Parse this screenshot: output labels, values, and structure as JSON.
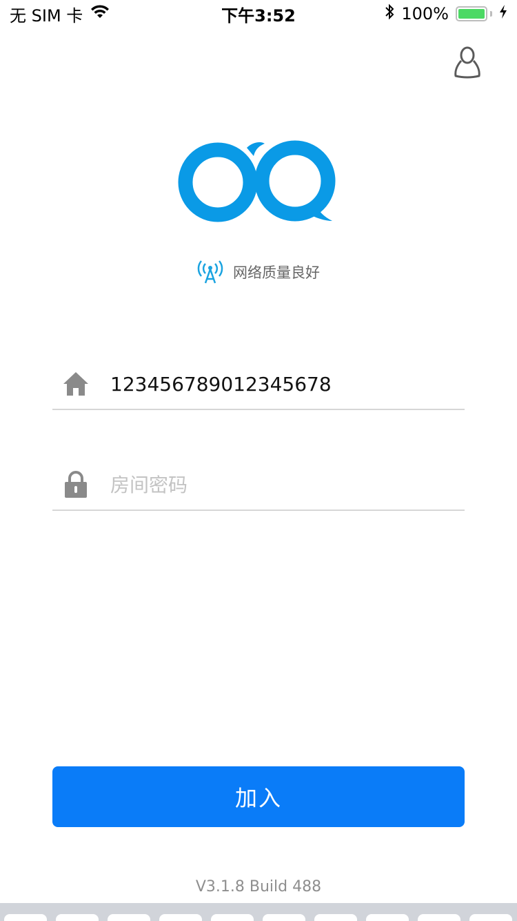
{
  "status_bar": {
    "carrier": "无 SIM 卡",
    "time": "下午3:52",
    "battery_percent": "100%",
    "battery_level": 1.0,
    "battery_color": "#4cd964"
  },
  "header": {
    "profile_icon": "user-icon"
  },
  "logo": {
    "icon": "app-logo",
    "color": "#0a9ae6"
  },
  "network": {
    "icon": "signal-tower-icon",
    "status_text": "网络质量良好"
  },
  "form": {
    "room_field": {
      "icon": "home-icon",
      "value": "123456789012345678",
      "placeholder": ""
    },
    "password_field": {
      "icon": "lock-icon",
      "value": "",
      "placeholder": "房间密码"
    },
    "join_label": "加入",
    "accent_color": "#0a7cf8"
  },
  "footer": {
    "version": "V3.1.8 Build 488"
  }
}
